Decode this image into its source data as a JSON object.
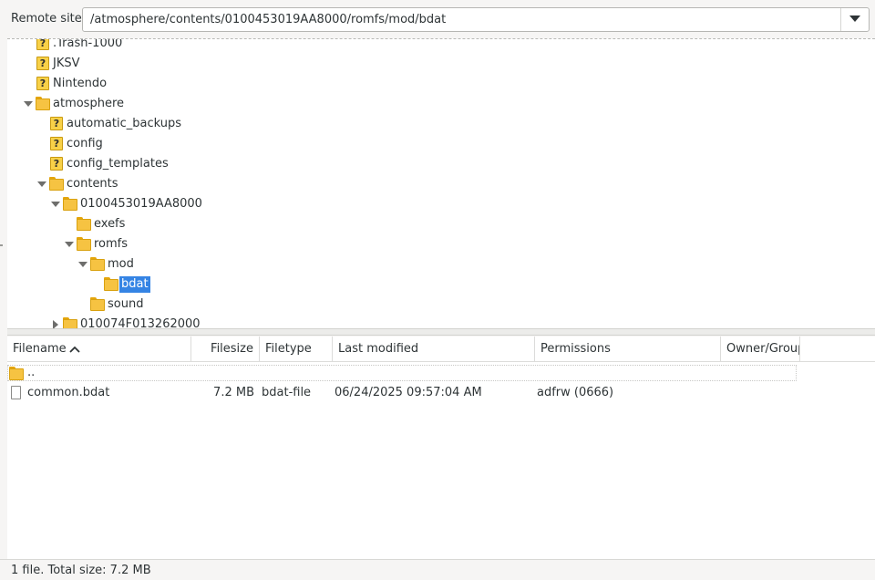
{
  "remote_site": {
    "label": "Remote site:",
    "path": "/atmosphere/contents/0100453019AA8000/romfs/mod/bdat"
  },
  "tree": {
    "items": [
      {
        "label": ".Trash-1000",
        "icon": "unknown-folder-icon",
        "depth": 2,
        "expander": "none",
        "selected": false
      },
      {
        "label": "JKSV",
        "icon": "unknown-folder-icon",
        "depth": 2,
        "expander": "none",
        "selected": false
      },
      {
        "label": "Nintendo",
        "icon": "unknown-folder-icon",
        "depth": 2,
        "expander": "none",
        "selected": false
      },
      {
        "label": "atmosphere",
        "icon": "folder-icon",
        "depth": 2,
        "expander": "expanded",
        "selected": false
      },
      {
        "label": "automatic_backups",
        "icon": "unknown-folder-icon",
        "depth": 3,
        "expander": "none",
        "selected": false
      },
      {
        "label": "config",
        "icon": "unknown-folder-icon",
        "depth": 3,
        "expander": "none",
        "selected": false
      },
      {
        "label": "config_templates",
        "icon": "unknown-folder-icon",
        "depth": 3,
        "expander": "none",
        "selected": false
      },
      {
        "label": "contents",
        "icon": "folder-icon",
        "depth": 3,
        "expander": "expanded",
        "selected": false
      },
      {
        "label": "0100453019AA8000",
        "icon": "folder-icon",
        "depth": 4,
        "expander": "expanded",
        "selected": false
      },
      {
        "label": "exefs",
        "icon": "folder-icon",
        "depth": 5,
        "expander": "none",
        "selected": false
      },
      {
        "label": "romfs",
        "icon": "folder-icon",
        "depth": 5,
        "expander": "expanded",
        "selected": false
      },
      {
        "label": "mod",
        "icon": "folder-icon",
        "depth": 6,
        "expander": "expanded",
        "selected": false
      },
      {
        "label": "bdat",
        "icon": "folder-icon",
        "depth": 7,
        "expander": "none",
        "selected": true
      },
      {
        "label": "sound",
        "icon": "folder-icon",
        "depth": 6,
        "expander": "none",
        "selected": false
      },
      {
        "label": "010074F013262000",
        "icon": "folder-icon",
        "depth": 4,
        "expander": "collapsed",
        "selected": false
      }
    ]
  },
  "file_list": {
    "columns": [
      "Filename",
      "Filesize",
      "Filetype",
      "Last modified",
      "Permissions",
      "Owner/Group"
    ],
    "sort_column": "Filename",
    "sort_direction": "ascending",
    "parent_label": "..",
    "rows": [
      {
        "name": "common.bdat",
        "size": "7.2 MB",
        "type": "bdat-file",
        "modified": "06/24/2025 09:57:04 AM",
        "permissions": "adfrw (0666)",
        "owner": ""
      }
    ]
  },
  "status": {
    "text": "1 file. Total size: 7.2 MB"
  },
  "colors": {
    "selection": "#3584e4",
    "folder": "#f6c342",
    "background": "#f6f5f4"
  }
}
